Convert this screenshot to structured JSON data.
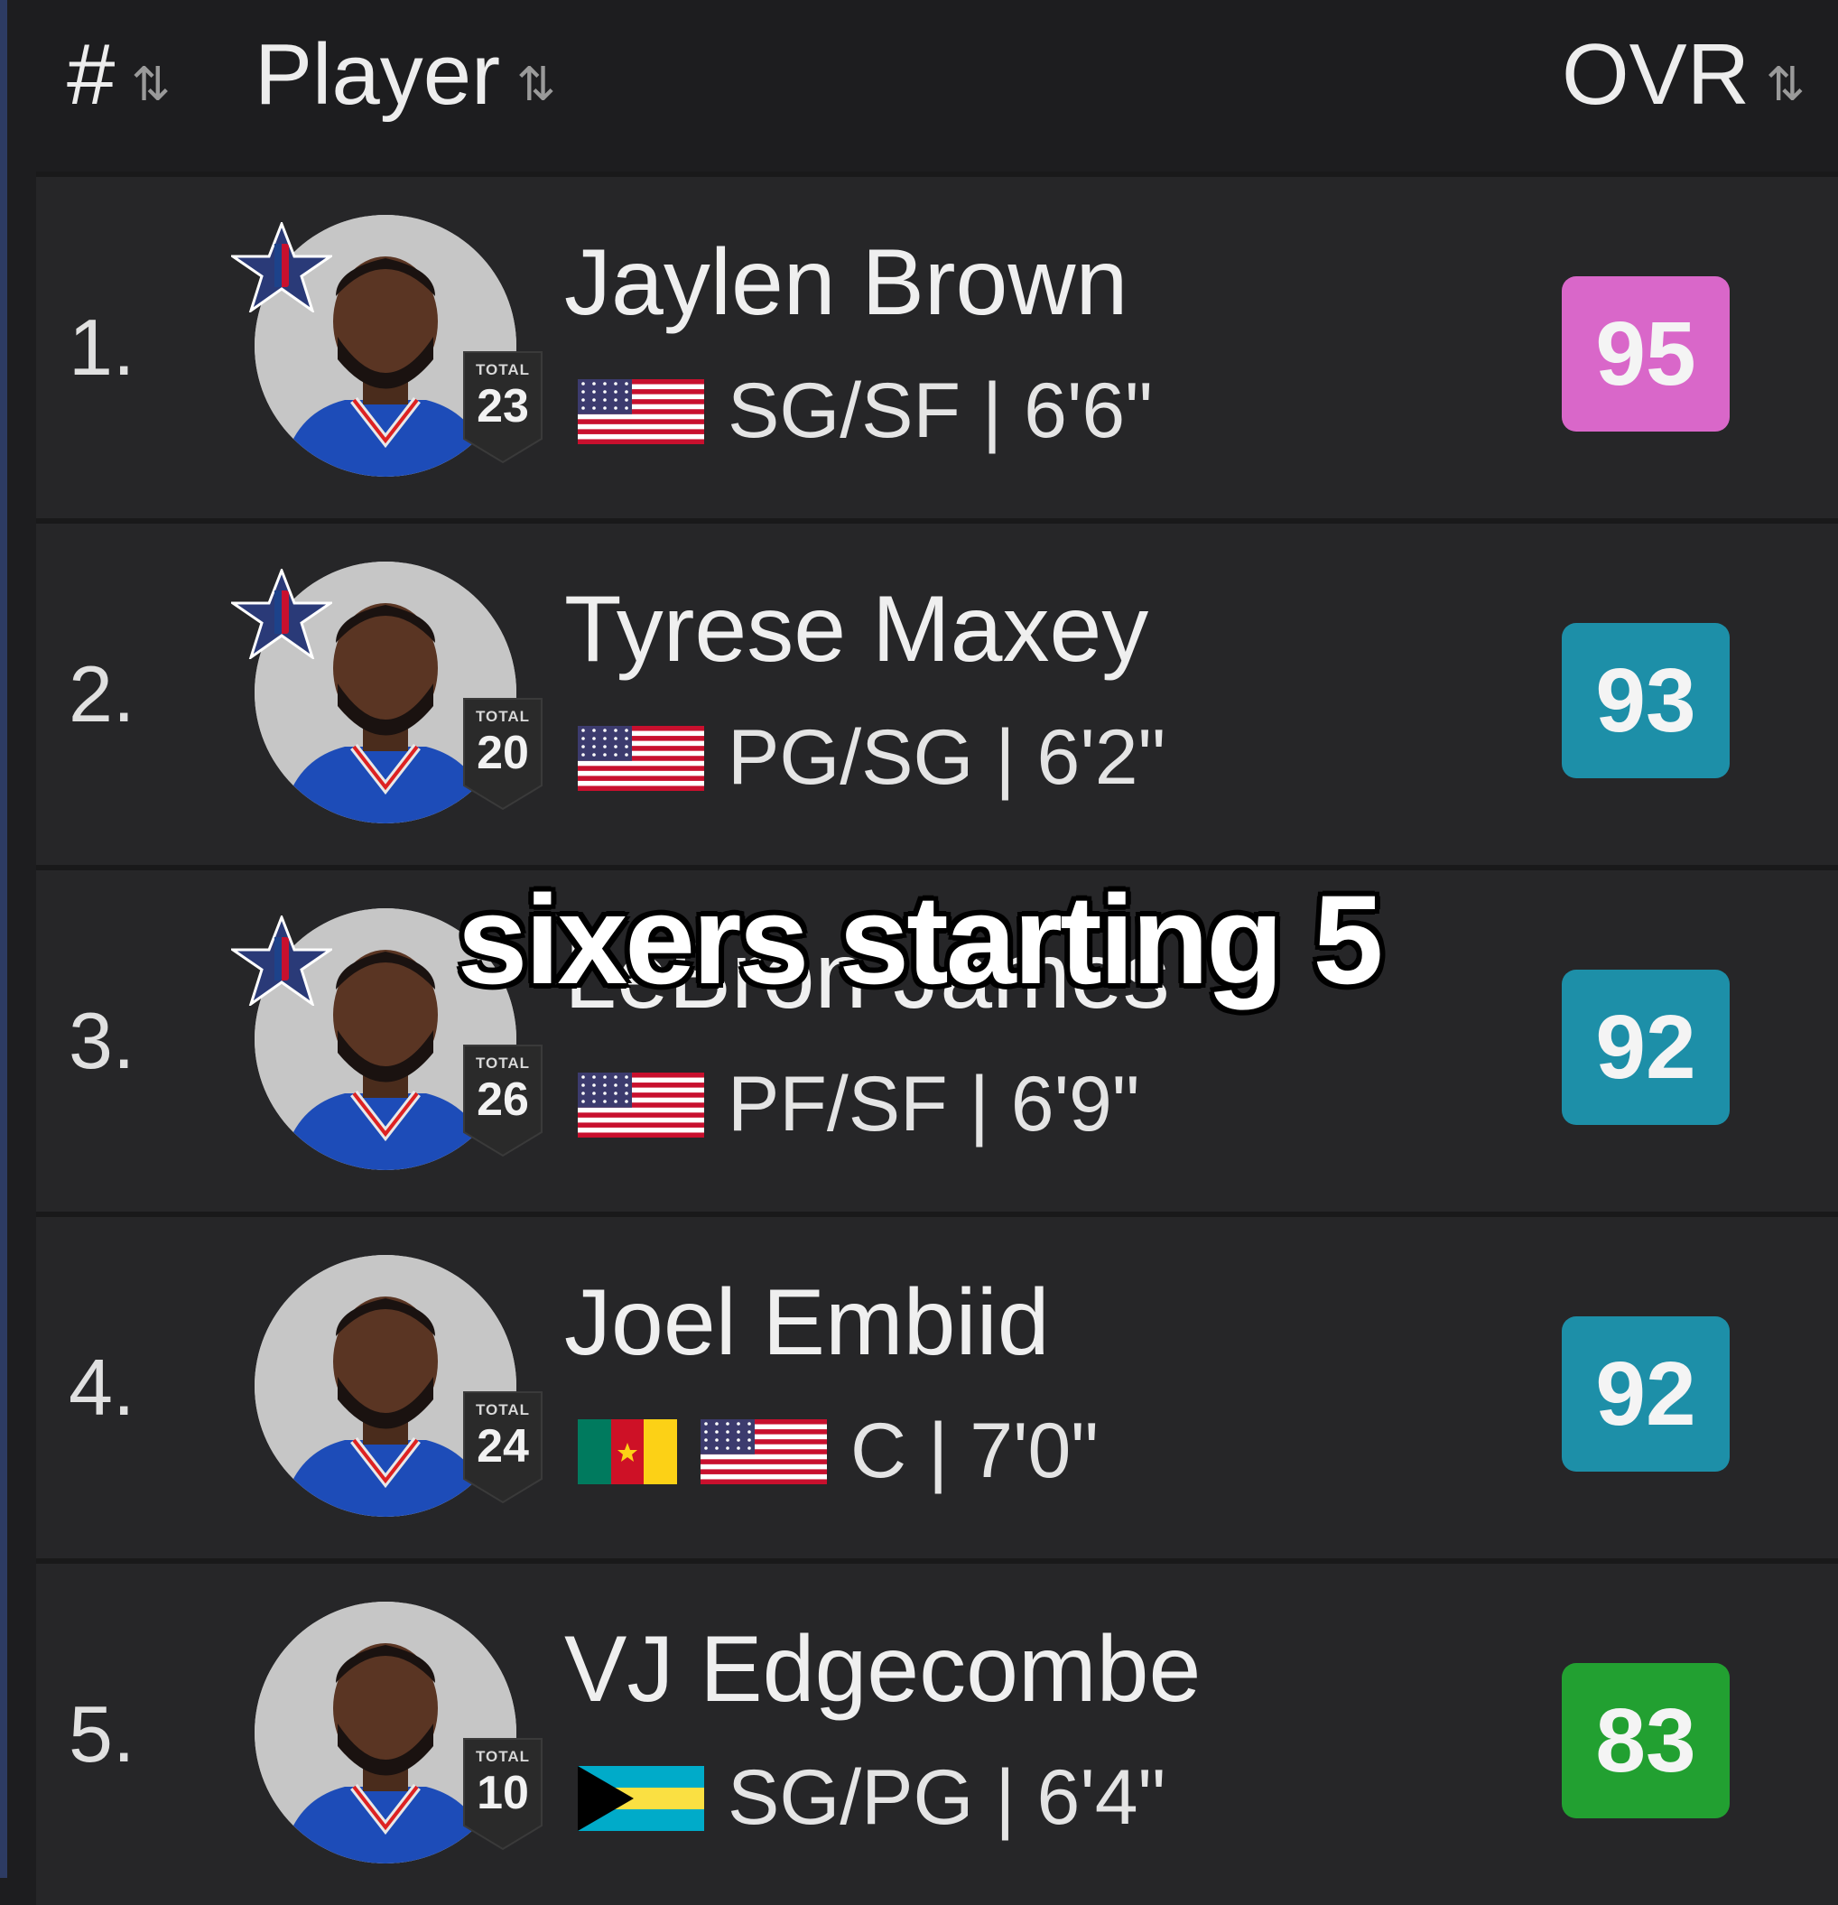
{
  "header": {
    "rank_label": "#",
    "player_label": "Player",
    "ovr_label": "OVR",
    "sort_glyph": "⇅"
  },
  "rows": [
    {
      "rank": "1.",
      "name": "Jaylen Brown",
      "total_label": "TOTAL",
      "total": "23",
      "info": "SG/SF | 6'6\"",
      "ovr": "95",
      "ovr_color": "#d967c9",
      "flags": [
        "usa"
      ],
      "allstar": true
    },
    {
      "rank": "2.",
      "name": "Tyrese Maxey",
      "total_label": "TOTAL",
      "total": "20",
      "info": "PG/SG | 6'2\"",
      "ovr": "93",
      "ovr_color": "#1d8fa8",
      "flags": [
        "usa"
      ],
      "allstar": true
    },
    {
      "rank": "3.",
      "name": "LeBron James",
      "total_label": "TOTAL",
      "total": "26",
      "info": "PF/SF | 6'9\"",
      "ovr": "92",
      "ovr_color": "#1d8fa8",
      "flags": [
        "usa"
      ],
      "allstar": true
    },
    {
      "rank": "4.",
      "name": "Joel Embiid",
      "total_label": "TOTAL",
      "total": "24",
      "info": "C | 7'0\"",
      "ovr": "92",
      "ovr_color": "#1d8fa8",
      "flags": [
        "cameroon",
        "usa"
      ],
      "allstar": false
    },
    {
      "rank": "5.",
      "name": "VJ Edgecombe",
      "total_label": "TOTAL",
      "total": "10",
      "info": "SG/PG | 6'4\"",
      "ovr": "83",
      "ovr_color": "#22a031",
      "flags": [
        "bahamas"
      ],
      "allstar": false
    }
  ],
  "overlay_caption": "sixers starting 5"
}
